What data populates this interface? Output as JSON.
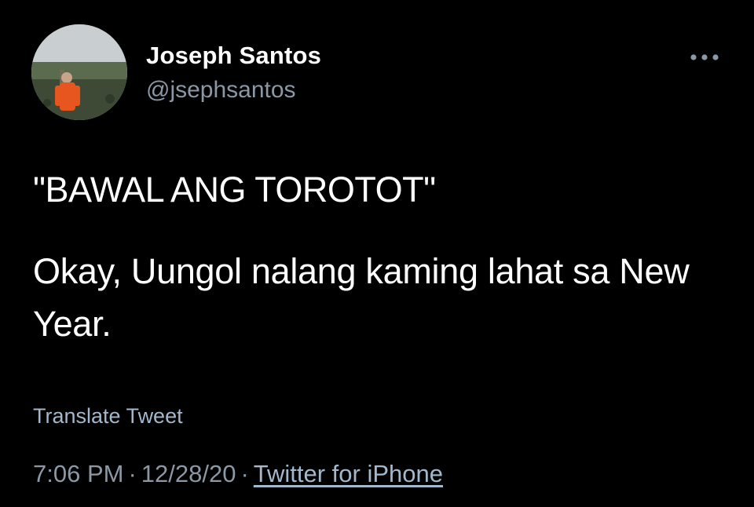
{
  "tweet": {
    "author": {
      "display_name": "Joseph Santos",
      "handle": "@jsephsantos",
      "avatar_icon": "profile-photo"
    },
    "more_icon": "more-options-icon",
    "text_line_1": "\"BAWAL ANG TOROTOT\"",
    "text_line_2": "Okay, Uungol nalang kaming lahat sa New Year.",
    "translate_label": "Translate Tweet",
    "time": "7:06 PM",
    "separator": "·",
    "date": "12/28/20",
    "source": "Twitter for iPhone"
  },
  "colors": {
    "background": "#000000",
    "text_primary": "#ffffff",
    "text_secondary": "#8b98a5",
    "link": "#a3b8cc"
  }
}
